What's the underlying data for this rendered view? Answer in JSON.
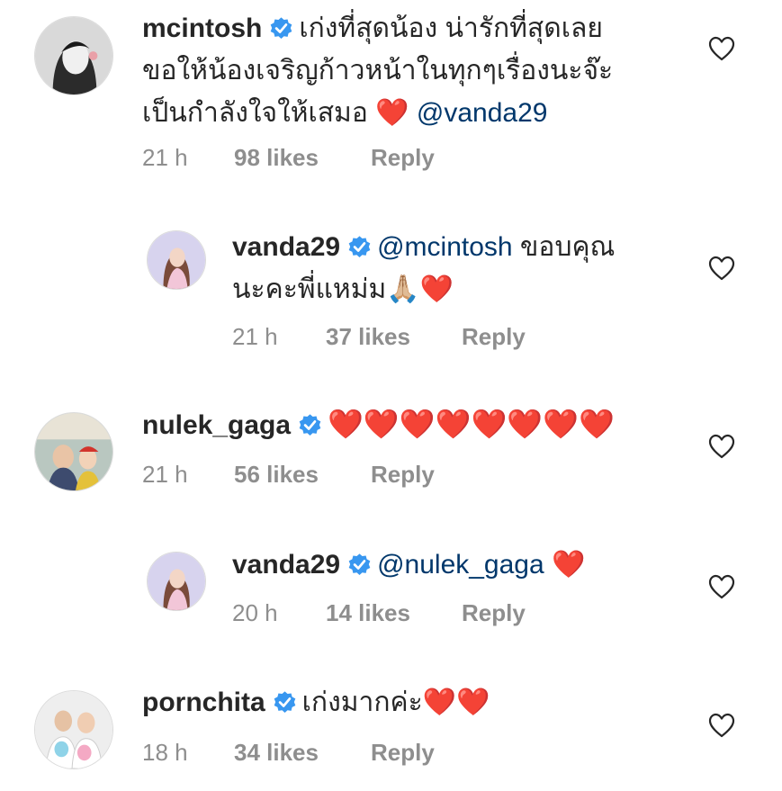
{
  "comments": [
    {
      "username": "mcintosh",
      "lines": [
        "เก่งที่สุดน้อง น่ารักที่สุดเลย",
        "ขอให้น้องเจริญก้าวหน้าในทุกๆเรื่องนะจ๊ะ",
        "เป็นกำลังใจให้เสมอ"
      ],
      "emoji": "❤️",
      "mention": "@vanda29",
      "time": "21 h",
      "likes": "98 likes",
      "reply": "Reply"
    },
    {
      "username": "vanda29",
      "mention": "@mcintosh",
      "text_line1": "ขอบคุณ",
      "text_line2": "นะคะพี่แหม่ม",
      "emoji": "🙏🏼❤️",
      "time": "21 h",
      "likes": "37 likes",
      "reply": "Reply"
    },
    {
      "username": "nulek_gaga",
      "emoji": "❤️❤️❤️❤️❤️❤️❤️❤️",
      "time": "21 h",
      "likes": "56 likes",
      "reply": "Reply"
    },
    {
      "username": "vanda29",
      "mention": "@nulek_gaga",
      "emoji": "❤️",
      "time": "20 h",
      "likes": "14 likes",
      "reply": "Reply"
    },
    {
      "username": "pornchita",
      "text": "เก่งมากค่ะ",
      "emoji": "❤️❤️",
      "time": "18 h",
      "likes": "34 likes",
      "reply": "Reply"
    }
  ],
  "colors": {
    "verified": "#3897f0",
    "mention": "#00376b",
    "meta": "#8e8e8e",
    "heart": "#e0202c"
  },
  "icons": {
    "verified": "verified-badge-icon",
    "like": "heart-outline-icon"
  }
}
